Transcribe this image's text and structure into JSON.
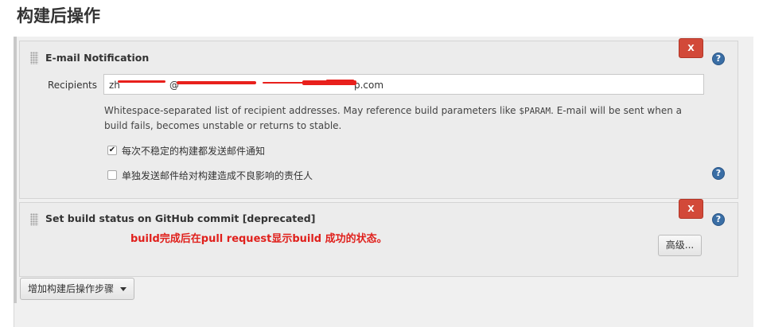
{
  "page": {
    "title": "构建后操作"
  },
  "email_notification": {
    "title": "E-mail Notification",
    "remove_label": "X",
    "help_label": "?",
    "recipients_label": "Recipients",
    "recipients_value_visible_1": "zh",
    "recipients_value_visible_2": "@",
    "recipients_value_visible_3": "p.com",
    "description_1": "Whitespace-separated list of recipient addresses. May reference build parameters like ",
    "description_param": "$PARAM",
    "description_2": ". E-mail will be sent when a build fails, becomes unstable or returns to stable.",
    "checkbox_unstable_label": "每次不稳定的构建都发送邮件通知",
    "checkbox_unstable_checked": true,
    "checkbox_individual_label": "单独发送邮件给对构建造成不良影响的责任人",
    "checkbox_individual_checked": false
  },
  "github_status": {
    "title": "Set build status on GitHub commit [deprecated]",
    "remove_label": "X",
    "help_label": "?",
    "annotation": "build完成后在pull request显示build 成功的状态。",
    "advanced_button": "高级..."
  },
  "add_step": {
    "label": "增加构建后操作步骤"
  },
  "colors": {
    "remove_button": "#d24939",
    "help_icon": "#3a6ea5",
    "annotation": "#e0201c",
    "redaction": "#e8201c"
  }
}
